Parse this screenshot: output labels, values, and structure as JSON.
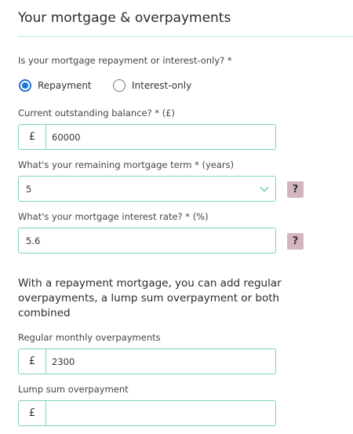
{
  "section": {
    "title": "Your mortgage & overpayments"
  },
  "repayment_type": {
    "label": "Is your mortgage repayment or interest-only? *",
    "options": [
      {
        "label": "Repayment",
        "selected": true
      },
      {
        "label": "Interest-only",
        "selected": false
      }
    ]
  },
  "balance": {
    "label": "Current outstanding balance? * (£)",
    "prefix": "£",
    "value": "60000"
  },
  "term": {
    "label": "What's your remaining mortgage term * (years)",
    "value": "5",
    "help": "?"
  },
  "rate": {
    "label": "What's your mortgage interest rate? * (%)",
    "value": "5.6",
    "help": "?"
  },
  "info_text": "With a repayment mortgage, you can add regular overpayments, a lump sum overpayment or both combined",
  "monthly_overpayment": {
    "label": "Regular monthly overpayments",
    "prefix": "£",
    "value": "2300"
  },
  "lump_sum": {
    "label": "Lump sum overpayment",
    "prefix": "£",
    "value": ""
  },
  "colors": {
    "accent": "#1e73d7",
    "border": "#7fd1c2",
    "help_bg": "#d3b5c0"
  },
  "icons": {
    "dropdown": "chevron-down-icon",
    "help": "question-mark-icon"
  }
}
